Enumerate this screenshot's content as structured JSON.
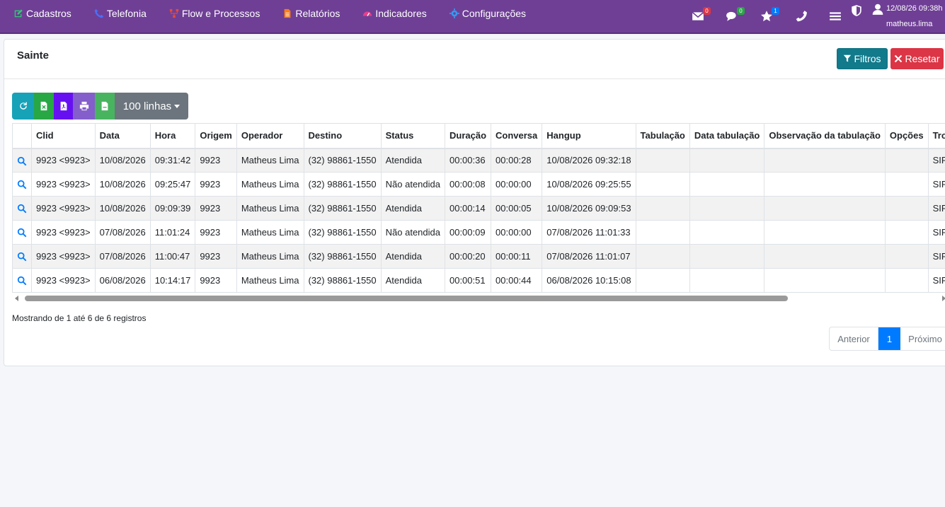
{
  "nav": {
    "items": [
      {
        "label": "Cadastros",
        "icon": "edit-icon",
        "color": "#2ecc71"
      },
      {
        "label": "Telefonia",
        "icon": "phone-icon",
        "color": "#3b5bdb"
      },
      {
        "label": "Flow e Processos",
        "icon": "flow-icon",
        "color": "#e74c3c"
      },
      {
        "label": "Relatórios",
        "icon": "file-icon",
        "color": "#fd7e14"
      },
      {
        "label": "Indicadores",
        "icon": "gauge-icon",
        "color": "#e83e8c"
      },
      {
        "label": "Configurações",
        "icon": "gear-icon",
        "color": "#17a2b8"
      }
    ],
    "badges": {
      "mail": "0",
      "chat": "0",
      "star": "1"
    },
    "datetime": "12/08/26 09:38h",
    "username": "matheus.lima"
  },
  "card": {
    "title": "Sainte",
    "filters_label": "Filtros",
    "reset_label": "Resetar"
  },
  "toolbar": {
    "lines_label": "100 linhas"
  },
  "table": {
    "headers": [
      "",
      "Clid",
      "Data",
      "Hora",
      "Origem",
      "Operador",
      "Destino",
      "Status",
      "Duração",
      "Conversa",
      "Hangup",
      "Tabulação",
      "Data tabulação",
      "Observação da tabulação",
      "Opções",
      "Tronco"
    ],
    "rows": [
      [
        "9923 <9923>",
        "10/08/2026",
        "09:31:42",
        "9923",
        "Matheus Lima",
        "(32) 98861-1550",
        "Atendida",
        "00:00:36",
        "00:00:28",
        "10/08/2026 09:32:18",
        "",
        "",
        "",
        "",
        "SIP S"
      ],
      [
        "9923 <9923>",
        "10/08/2026",
        "09:25:47",
        "9923",
        "Matheus Lima",
        "(32) 98861-1550",
        "Não atendida",
        "00:00:08",
        "00:00:00",
        "10/08/2026 09:25:55",
        "",
        "",
        "",
        "",
        "SIP S"
      ],
      [
        "9923 <9923>",
        "10/08/2026",
        "09:09:39",
        "9923",
        "Matheus Lima",
        "(32) 98861-1550",
        "Atendida",
        "00:00:14",
        "00:00:05",
        "10/08/2026 09:09:53",
        "",
        "",
        "",
        "",
        "SIP S"
      ],
      [
        "9923 <9923>",
        "07/08/2026",
        "11:01:24",
        "9923",
        "Matheus Lima",
        "(32) 98861-1550",
        "Não atendida",
        "00:00:09",
        "00:00:00",
        "07/08/2026 11:01:33",
        "",
        "",
        "",
        "",
        "SIP S"
      ],
      [
        "9923 <9923>",
        "07/08/2026",
        "11:00:47",
        "9923",
        "Matheus Lima",
        "(32) 98861-1550",
        "Atendida",
        "00:00:20",
        "00:00:11",
        "07/08/2026 11:01:07",
        "",
        "",
        "",
        "",
        "SIP S"
      ],
      [
        "9923 <9923>",
        "06/08/2026",
        "10:14:17",
        "9923",
        "Matheus Lima",
        "(32) 98861-1550",
        "Atendida",
        "00:00:51",
        "00:00:44",
        "06/08/2026 10:15:08",
        "",
        "",
        "",
        "",
        "SIP S"
      ]
    ]
  },
  "footer": {
    "info": "Mostrando de 1 até 6 de 6 registros",
    "prev_label": "Anterior",
    "page": "1",
    "next_label": "Próximo"
  }
}
